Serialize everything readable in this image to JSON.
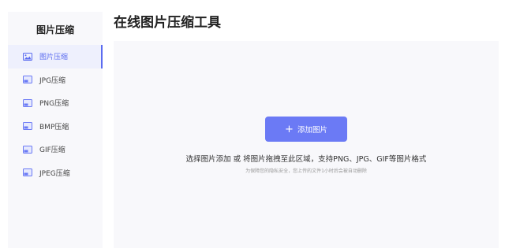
{
  "sidebar": {
    "title": "图片压缩",
    "items": [
      {
        "label": "图片压缩",
        "icon": "image-icon",
        "active": true
      },
      {
        "label": "JPG压缩",
        "icon": "jpg-file-icon",
        "active": false
      },
      {
        "label": "PNG压缩",
        "icon": "png-file-icon",
        "active": false
      },
      {
        "label": "BMP压缩",
        "icon": "bmp-file-icon",
        "active": false
      },
      {
        "label": "GIF压缩",
        "icon": "gif-file-icon",
        "active": false
      },
      {
        "label": "JPEG压缩",
        "icon": "jpeg-file-icon",
        "active": false
      }
    ]
  },
  "header": {
    "title": "在线图片压缩工具"
  },
  "dropzone": {
    "button_label": "添加图片",
    "instruction": "选择图片添加 或 将图片拖拽至此区域，支持PNG、JPG、GIF等图片格式",
    "privacy_note": "为保障您的隐私安全，您上传的文件1小时后会被自动删除"
  },
  "colors": {
    "accent": "#6b7af5",
    "active_text": "#5b6cf0",
    "active_bg": "#eef0fd",
    "panel_bg": "#f8f8fb"
  }
}
